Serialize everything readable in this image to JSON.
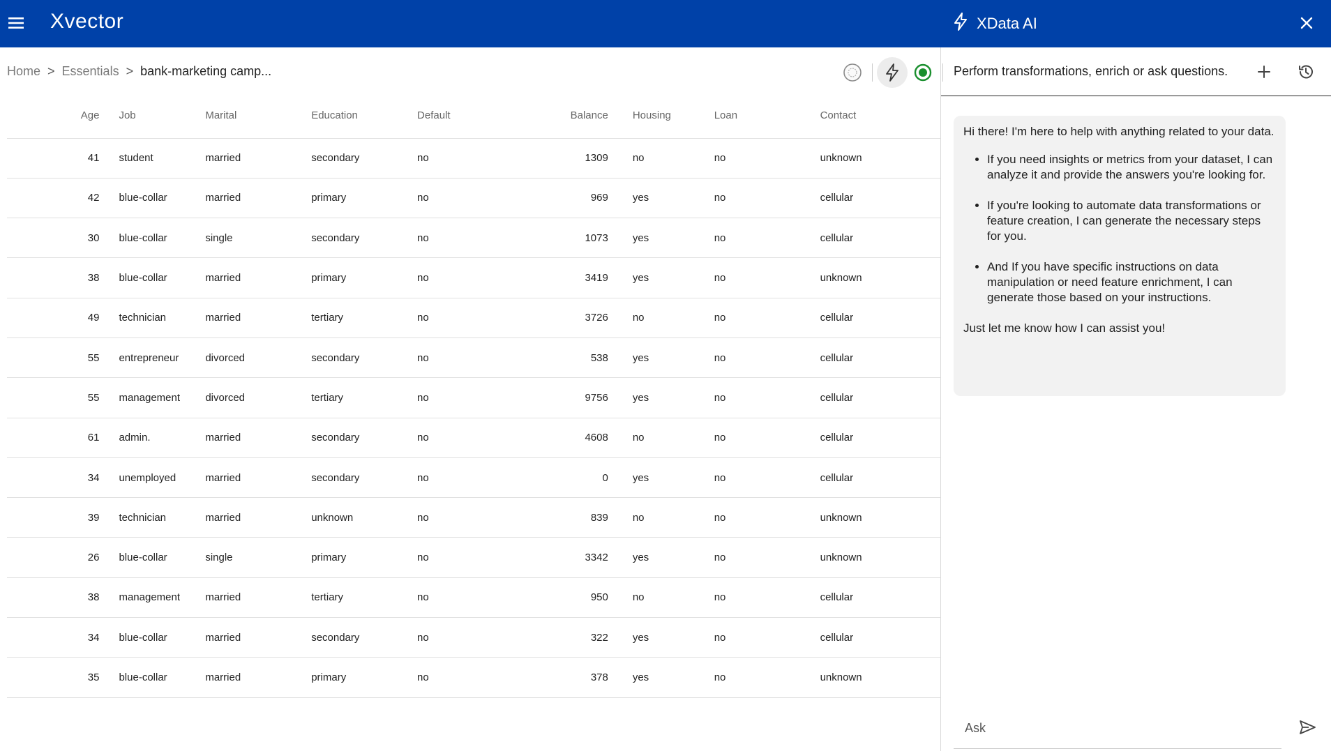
{
  "app": {
    "logo": "Xvector"
  },
  "ai_panel": {
    "title": "XData AI",
    "prompt": "Perform transformations, enrich or ask questions.",
    "message": {
      "intro": "Hi there! I'm here to help with anything related to your data.",
      "bullets": [
        "If you need insights or metrics from your dataset, I can analyze it and provide the answers you're looking for.",
        "If you're looking to automate data transformations or feature creation, I can generate the necessary steps for you.",
        "And If you have specific instructions on data manipulation or need feature enrichment, I can generate those based on your instructions."
      ],
      "outro": "Just let me know how I can assist you!"
    },
    "ask_placeholder": "Ask"
  },
  "breadcrumb": {
    "home": "Home",
    "essentials": "Essentials",
    "current": "bank-marketing camp...",
    "separator": ">"
  },
  "table": {
    "headers": [
      "Age",
      "Job",
      "Marital",
      "Education",
      "Default",
      "Balance",
      "Housing",
      "Loan",
      "Contact"
    ],
    "rows": [
      [
        "41",
        "student",
        "married",
        "secondary",
        "no",
        "1309",
        "no",
        "no",
        "unknown"
      ],
      [
        "42",
        "blue-collar",
        "married",
        "primary",
        "no",
        "969",
        "yes",
        "no",
        "cellular"
      ],
      [
        "30",
        "blue-collar",
        "single",
        "secondary",
        "no",
        "1073",
        "yes",
        "no",
        "cellular"
      ],
      [
        "38",
        "blue-collar",
        "married",
        "primary",
        "no",
        "3419",
        "yes",
        "no",
        "unknown"
      ],
      [
        "49",
        "technician",
        "married",
        "tertiary",
        "no",
        "3726",
        "no",
        "no",
        "cellular"
      ],
      [
        "55",
        "entrepreneur",
        "divorced",
        "secondary",
        "no",
        "538",
        "yes",
        "no",
        "cellular"
      ],
      [
        "55",
        "management",
        "divorced",
        "tertiary",
        "no",
        "9756",
        "yes",
        "no",
        "cellular"
      ],
      [
        "61",
        "admin.",
        "married",
        "secondary",
        "no",
        "4608",
        "no",
        "no",
        "cellular"
      ],
      [
        "34",
        "unemployed",
        "married",
        "secondary",
        "no",
        "0",
        "yes",
        "no",
        "cellular"
      ],
      [
        "39",
        "technician",
        "married",
        "unknown",
        "no",
        "839",
        "no",
        "no",
        "unknown"
      ],
      [
        "26",
        "blue-collar",
        "single",
        "primary",
        "no",
        "3342",
        "yes",
        "no",
        "unknown"
      ],
      [
        "38",
        "management",
        "married",
        "tertiary",
        "no",
        "950",
        "no",
        "no",
        "cellular"
      ],
      [
        "34",
        "blue-collar",
        "married",
        "secondary",
        "no",
        "322",
        "yes",
        "no",
        "cellular"
      ],
      [
        "35",
        "blue-collar",
        "married",
        "primary",
        "no",
        "378",
        "yes",
        "no",
        "unknown"
      ]
    ]
  },
  "icons": {
    "menu": "hamburger-menu-icon",
    "ai": "lightning-bolt-icon",
    "close": "close-icon",
    "new_chat": "plus-icon",
    "history": "history-icon",
    "send": "send-icon",
    "status": "status-indicator-icon"
  },
  "colors": {
    "topbar": "#0041a8",
    "status_green": "#1a8f2e",
    "bubble": "#f2f2f2"
  }
}
